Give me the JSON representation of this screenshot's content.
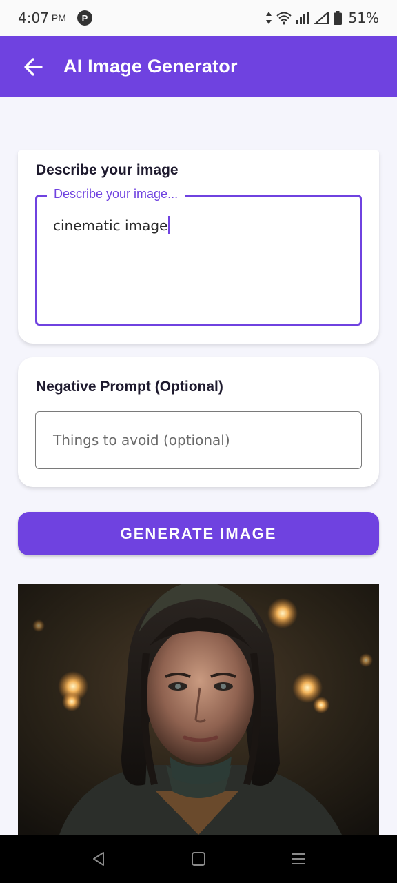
{
  "status": {
    "time": "4:07",
    "ampm": "PM",
    "notification_glyph": "P",
    "battery": "51%",
    "icons": [
      "data-arrows-icon",
      "wifi-icon",
      "signal-icon",
      "signal-empty-icon",
      "battery-icon"
    ]
  },
  "app_bar": {
    "title": "AI Image Generator",
    "back_icon": "arrow-left-icon",
    "color": "#6f42e0"
  },
  "prompt_card": {
    "title": "Describe your image",
    "field_label": "Describe your image...",
    "value": "cinematic image"
  },
  "negative_card": {
    "title": "Negative Prompt (Optional)",
    "placeholder": "Things to avoid (optional)"
  },
  "generate_button": {
    "label": "GENERATE IMAGE"
  },
  "result_image": {
    "description_icon": "generated-portrait-image"
  },
  "nav": {
    "icons": [
      "back-triangle-icon",
      "home-square-icon",
      "menu-lines-icon"
    ]
  }
}
